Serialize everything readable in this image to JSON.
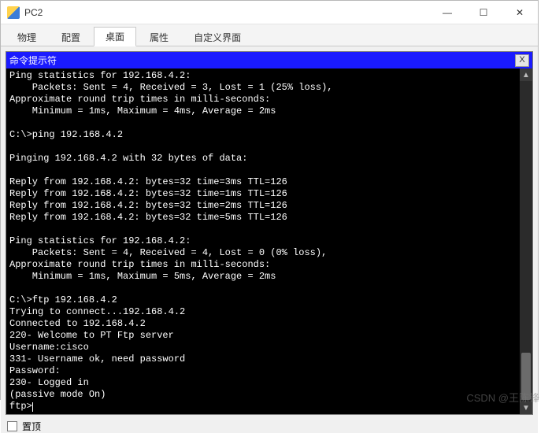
{
  "window": {
    "title": "PC2",
    "min": "—",
    "max": "☐",
    "close": "✕"
  },
  "tabs": {
    "items": [
      {
        "label": "物理"
      },
      {
        "label": "配置"
      },
      {
        "label": "桌面"
      },
      {
        "label": "属性"
      },
      {
        "label": "自定义界面"
      }
    ],
    "active_index": 2
  },
  "inner_window": {
    "title": "命令提示符",
    "close": "X"
  },
  "terminal": {
    "lines": [
      "Ping statistics for 192.168.4.2:",
      "    Packets: Sent = 4, Received = 3, Lost = 1 (25% loss),",
      "Approximate round trip times in milli-seconds:",
      "    Minimum = 1ms, Maximum = 4ms, Average = 2ms",
      "",
      "C:\\>ping 192.168.4.2",
      "",
      "Pinging 192.168.4.2 with 32 bytes of data:",
      "",
      "Reply from 192.168.4.2: bytes=32 time=3ms TTL=126",
      "Reply from 192.168.4.2: bytes=32 time=1ms TTL=126",
      "Reply from 192.168.4.2: bytes=32 time=2ms TTL=126",
      "Reply from 192.168.4.2: bytes=32 time=5ms TTL=126",
      "",
      "Ping statistics for 192.168.4.2:",
      "    Packets: Sent = 4, Received = 4, Lost = 0 (0% loss),",
      "Approximate round trip times in milli-seconds:",
      "    Minimum = 1ms, Maximum = 5ms, Average = 2ms",
      "",
      "C:\\>ftp 192.168.4.2",
      "Trying to connect...192.168.4.2",
      "Connected to 192.168.4.2",
      "220- Welcome to PT Ftp server",
      "Username:cisco",
      "331- Username ok, need password",
      "Password:",
      "230- Logged in",
      "(passive mode On)",
      "ftp>"
    ]
  },
  "footer": {
    "option_label": "置顶"
  },
  "watermark": "CSDN @王陈锋"
}
